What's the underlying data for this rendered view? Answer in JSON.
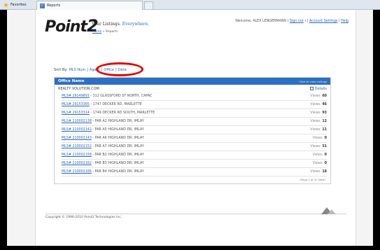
{
  "browser": {
    "favorites_label": "Favorites",
    "tab_title": "Reports"
  },
  "header": {
    "logo_text": "Point",
    "logo_num": "2",
    "tagline_lead": "Your Listings.",
    "tagline_accent": "Everywhere.",
    "breadcrumb_home": "Home",
    "breadcrumb_sep": " » ",
    "breadcrumb_current": "Reports",
    "welcome": "Welcome, ALEX LENGERMANN",
    "sign_out": "Sign out",
    "account_settings": "Account Settings",
    "help": "Help"
  },
  "sort": {
    "label": "Sort By:",
    "mls": "MLS Num",
    "agent": "Agent",
    "office": "Office",
    "date": "Date",
    "sep": "|"
  },
  "table": {
    "header_office": "Office Name",
    "header_hint": "Click to view Listings",
    "office_name": "REALTY VOLUTION.COM",
    "details": "Details",
    "views_prefix": "Views:",
    "rows": [
      {
        "mls": "MLS# 29149891",
        "addr": " - 312 GLASSFORD ST NORTH, CAPAC",
        "views": "60"
      },
      {
        "mls": "MLS# 29153365",
        "addr": " - 1747 DECKER RD, MARLETTE",
        "views": "46"
      },
      {
        "mls": "MLS# 29153314",
        "addr": " - 1749 DECKER RD SOUTH, MARLETTE",
        "views": "93"
      },
      {
        "mls": "MLS# 210002138",
        "addr": " - PAR A2 HIGHLAND DR, IMLAY",
        "views": "12"
      },
      {
        "mls": "MLS# 210002142",
        "addr": " - PAR A5 HIGHLAND DR, IMLAY",
        "views": "11"
      },
      {
        "mls": "MLS# 210002143",
        "addr": " - PAR A6 HIGHLAND DR, IMLAY",
        "views": "0"
      },
      {
        "mls": "MLS# 210002152",
        "addr": " - PAR A7 HIGHLAND DR, IMLAY",
        "views": "31"
      },
      {
        "mls": "MLS# 210002158",
        "addr": " - PAR B2 HIGHLAND DR, IMLAY",
        "views": "0"
      },
      {
        "mls": "MLS# 210002162",
        "addr": " - PAR B3 HIGHLAND DR, IMLAY",
        "views": "0"
      },
      {
        "mls": "MLS# 210002166",
        "addr": " - PAR B4 HIGHLAND DR, IMLAY",
        "views": "18"
      }
    ],
    "pager": "«Page 1 of 3» Next»"
  },
  "footer": {
    "copyright": "Copyright © 1996-2010 Point2 Technologies Inc."
  }
}
